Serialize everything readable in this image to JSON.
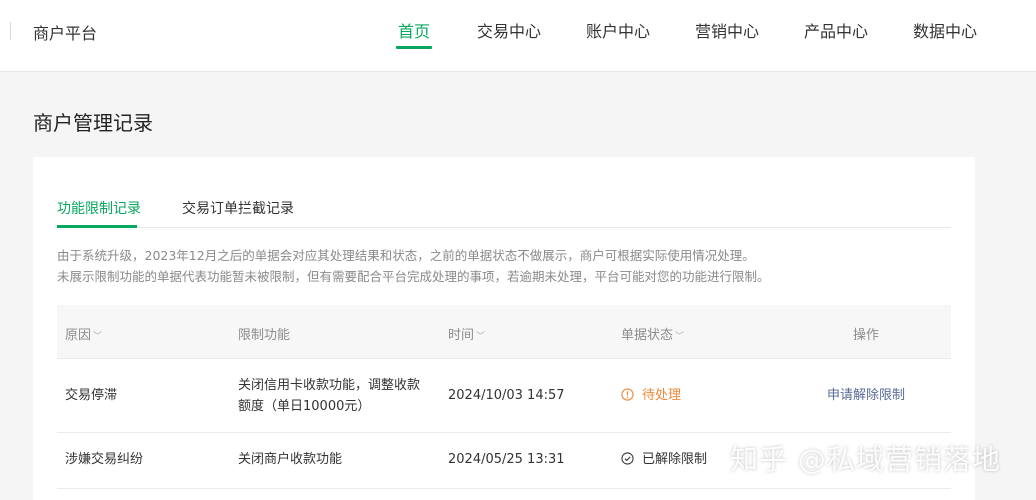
{
  "header": {
    "brand": "商户平台",
    "nav": [
      "首页",
      "交易中心",
      "账户中心",
      "营销中心",
      "产品中心",
      "数据中心"
    ],
    "active_nav": "首页"
  },
  "page": {
    "title": "商户管理记录"
  },
  "tabs": [
    "功能限制记录",
    "交易订单拦截记录"
  ],
  "notice": {
    "line1": "由于系统升级，2023年12月之后的单据会对应其处理结果和状态，之前的单据状态不做展示，商户可根据实际使用情况处理。",
    "line2": "未展示限制功能的单据代表功能暂未被限制，但有需要配合平台完成处理的事项，若逾期未处理，平台可能对您的功能进行限制。"
  },
  "table": {
    "headers": [
      "原因",
      "限制功能",
      "时间",
      "单据状态",
      "操作"
    ],
    "rows": [
      {
        "reason": "交易停滞",
        "function_line1": "关闭信用卡收款功能，调整收款",
        "function_line2": "额度（单日10000元）",
        "time": "2024/10/03 14:57",
        "status": "待处理",
        "action": "申请解除限制"
      },
      {
        "reason": "涉嫌交易纠纷",
        "function_line1": "关闭商户收款功能",
        "time": "2024/05/25 13:31",
        "status": "已解除限制"
      }
    ]
  },
  "watermark": "知乎 @私域营销落地",
  "colors": {
    "accent": "#07a75f",
    "pending": "#f0883a",
    "link": "#576b95"
  }
}
